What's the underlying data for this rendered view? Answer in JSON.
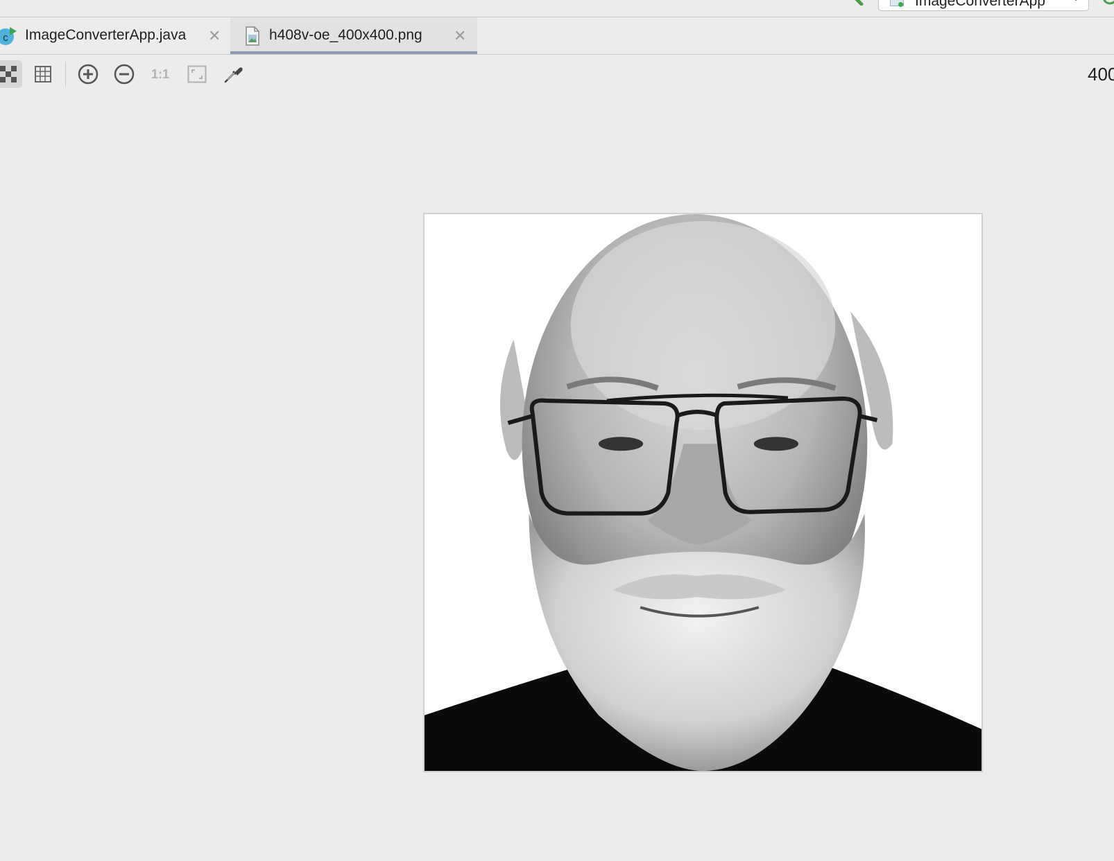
{
  "run_config": {
    "label": "ImageConverterApp"
  },
  "tabs": [
    {
      "label": "ImageConverterApp.java",
      "icon": "java-class-icon",
      "active": false
    },
    {
      "label": "h408v-oe_400x400.png",
      "icon": "image-file-icon",
      "active": true
    }
  ],
  "toolbar": {
    "buttons": [
      {
        "name": "chessboard-background-toggle",
        "icon": "chessboard-icon",
        "active": true
      },
      {
        "name": "grid-toggle",
        "icon": "grid-icon",
        "active": false
      },
      {
        "name": "zoom-in",
        "icon": "zoom-in-icon"
      },
      {
        "name": "zoom-out",
        "icon": "zoom-out-icon"
      },
      {
        "name": "actual-size",
        "icon": "actual-size-icon",
        "label": "1:1"
      },
      {
        "name": "fit-zoom",
        "icon": "fit-to-window-icon"
      },
      {
        "name": "color-picker",
        "icon": "eyedropper-icon"
      }
    ],
    "image_size_text": "400"
  },
  "image": {
    "description_icon": "portrait-photo",
    "colors": {
      "skin": "#bdbdbd",
      "shirt": "#0a0a0a",
      "frame": "#2a2a2a"
    }
  },
  "colors": {
    "background": "#ececec",
    "active_tab": "#e2e2e2",
    "tab_underline": "#8d9bb0",
    "border": "#c9c9c9"
  }
}
